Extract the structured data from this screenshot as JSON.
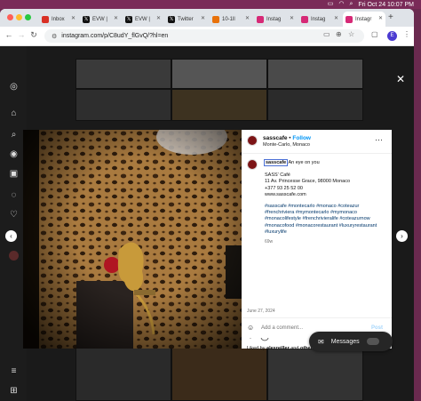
{
  "menubar": {
    "datetime": "Fri Oct 24 10:07 PM"
  },
  "tabs": [
    {
      "label": "Inbox",
      "fav_color": "#d93025"
    },
    {
      "label": "EVW |",
      "fav_color": "#111111"
    },
    {
      "label": "EVW |",
      "fav_color": "#111111"
    },
    {
      "label": "Twitter",
      "fav_color": "#111111"
    },
    {
      "label": "10-1ll",
      "fav_color": "#e8710a"
    },
    {
      "label": "Instag",
      "fav_color": "#d62976"
    },
    {
      "label": "Instag",
      "fav_color": "#d62976"
    },
    {
      "label": "Instagr",
      "fav_color": "#d62976"
    }
  ],
  "toolbar": {
    "url": "instagram.com/p/C8udY_flGvQ/?hl=en",
    "profile_initial": "E"
  },
  "post": {
    "username": "sasscafe",
    "follow_label": "Follow",
    "location": "Monte-Carlo, Monaco",
    "caption_user": "sasscafe",
    "caption_text": "An eye on you",
    "address_name": "SASS' Café",
    "address_line": "11 Av. Princesse Grace, 98000 Monaco",
    "phone": "+377 93 25 52 00",
    "website": "www.sasscafe.com",
    "hashtags": "#sasscafe #montecarlo #monaco #coteazur #frenchriviera #mymontecarlo #mymonaco #monacolifestyle #frenchrivieralife #coteazurnow #monacofood #monacorestaurant #luxuryrestaurant #luxurylife",
    "caption_age": "69w",
    "liked_prefix": "Liked by",
    "liked_user": "alexreiller",
    "liked_and": "and",
    "liked_others": "others",
    "date": "June 27, 2024",
    "comment_placeholder": "Add a comment...",
    "post_label": "Post"
  },
  "messages_label": "Messages",
  "colors": {
    "accent": "#0095f6",
    "menubar": "#7a2b58"
  }
}
